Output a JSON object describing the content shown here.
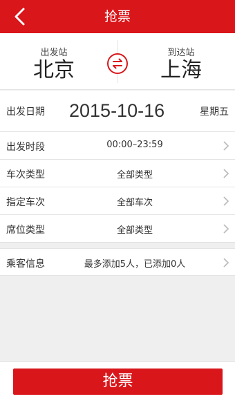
{
  "header": {
    "title": "抢票"
  },
  "stations": {
    "from_label": "出发站",
    "from_name": "北京",
    "to_label": "到达站",
    "to_name": "上海"
  },
  "date": {
    "label": "出发日期",
    "value": "2015-10-16",
    "weekday": "星期五"
  },
  "rows": [
    {
      "label": "出发时段",
      "value": "00:00–23:59"
    },
    {
      "label": "车次类型",
      "value": "全部类型"
    },
    {
      "label": "指定车次",
      "value": "全部车次"
    },
    {
      "label": "席位类型",
      "value": "全部类型"
    }
  ],
  "passenger": {
    "label": "乘客信息",
    "value": "最多添加5人，已添加0人"
  },
  "submit_label": "抢票",
  "colors": {
    "accent": "#d9161a",
    "background": "#efefef"
  },
  "icons": [
    "back-arrow-icon",
    "swap-icon",
    "chevron-right-icon"
  ]
}
